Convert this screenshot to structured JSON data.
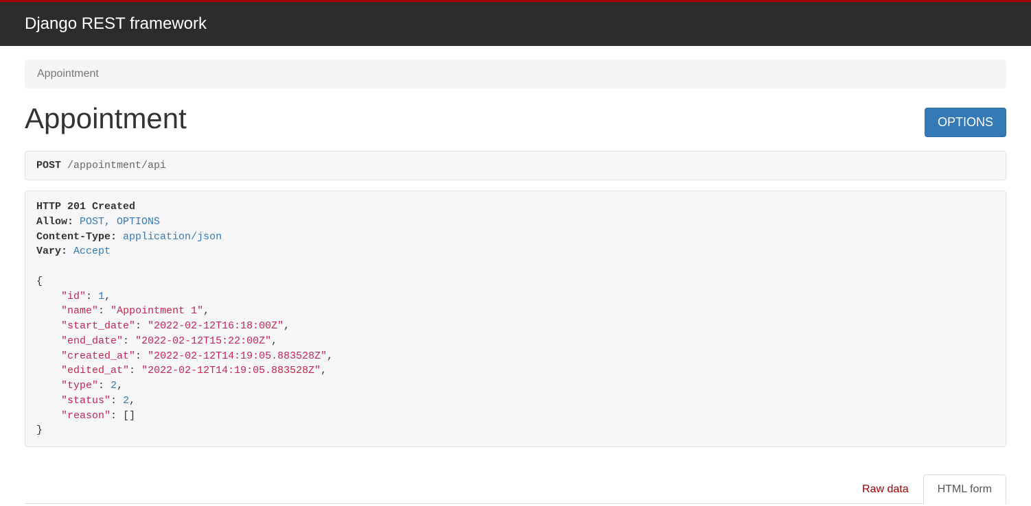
{
  "navbar": {
    "brand": "Django REST framework"
  },
  "breadcrumb": {
    "current": "Appointment"
  },
  "page": {
    "title": "Appointment",
    "options_button": "OPTIONS"
  },
  "request": {
    "method": "POST",
    "path": "/appointment/api"
  },
  "response": {
    "status_line": "HTTP 201 Created",
    "headers": [
      {
        "name": "Allow:",
        "value": "POST, OPTIONS"
      },
      {
        "name": "Content-Type:",
        "value": "application/json"
      },
      {
        "name": "Vary:",
        "value": "Accept"
      }
    ],
    "body": {
      "id": 1,
      "name": "Appointment 1",
      "start_date": "2022-02-12T16:18:00Z",
      "end_date": "2022-02-12T15:22:00Z",
      "created_at": "2022-02-12T14:19:05.883528Z",
      "edited_at": "2022-02-12T14:19:05.883528Z",
      "type": 2,
      "status": 2,
      "reason": []
    }
  },
  "tabs": {
    "raw_data": "Raw data",
    "html_form": "HTML form"
  }
}
